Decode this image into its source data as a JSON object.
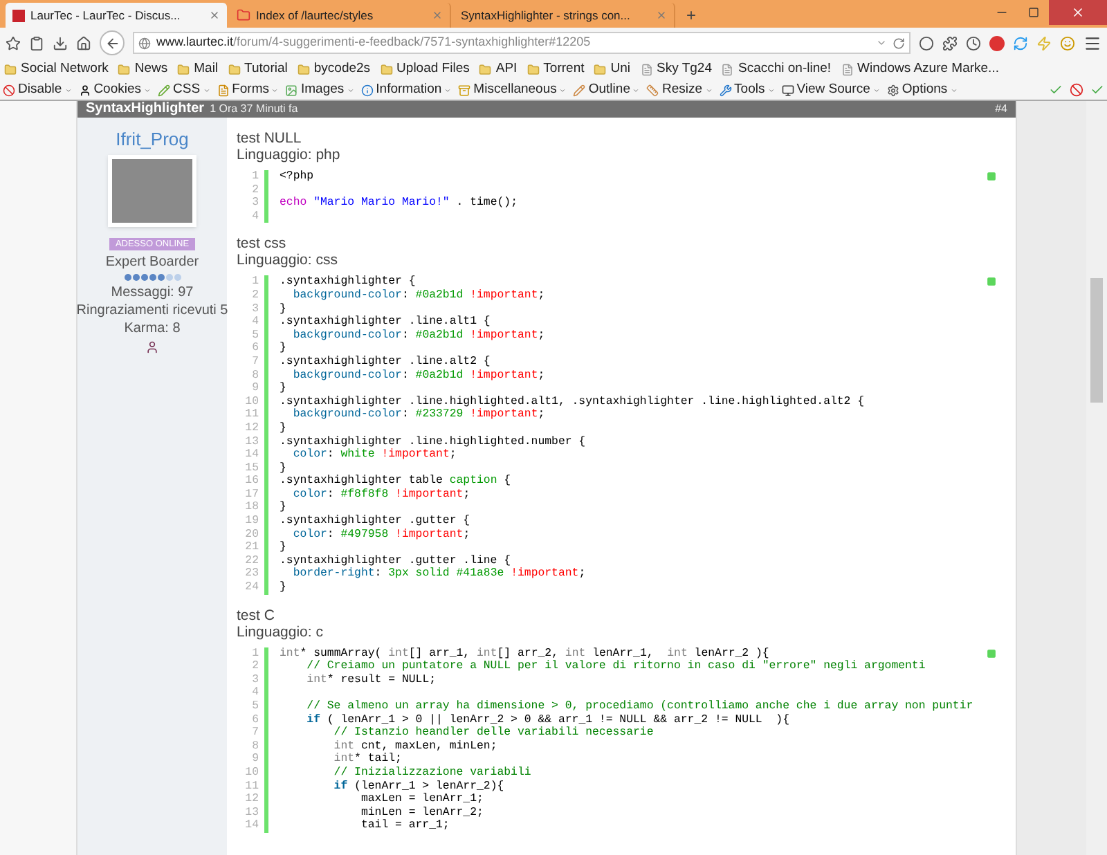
{
  "browser": {
    "tabs": [
      {
        "title": "LaurTec - LaurTec - Discus...",
        "selected": true
      },
      {
        "title": "Index of /laurtec/styles",
        "selected": false
      },
      {
        "title": "SyntaxHighlighter - strings con...",
        "selected": false
      }
    ],
    "new_tab": "+",
    "address": {
      "domain": "www.laurtec.it",
      "path": "/forum/4-suggerimenti-e-feedback/7571-syntaxhighlighter#12205"
    },
    "bookmarks": [
      {
        "label": "Social Network",
        "kind": "folder"
      },
      {
        "label": "News",
        "kind": "folder"
      },
      {
        "label": "Mail",
        "kind": "folder"
      },
      {
        "label": "Tutorial",
        "kind": "folder"
      },
      {
        "label": "bycode2s",
        "kind": "folder"
      },
      {
        "label": "Upload Files",
        "kind": "folder"
      },
      {
        "label": "API",
        "kind": "folder"
      },
      {
        "label": "Torrent",
        "kind": "folder"
      },
      {
        "label": "Uni",
        "kind": "folder"
      },
      {
        "label": "Sky Tg24",
        "kind": "page"
      },
      {
        "label": "Scacchi on-line!",
        "kind": "page"
      },
      {
        "label": "Windows Azure Marke...",
        "kind": "page"
      }
    ],
    "dev_toolbar": [
      {
        "label": "Disable",
        "kind": "disable"
      },
      {
        "label": "Cookies",
        "kind": "cookies"
      },
      {
        "label": "CSS",
        "kind": "css"
      },
      {
        "label": "Forms",
        "kind": "forms"
      },
      {
        "label": "Images",
        "kind": "images"
      },
      {
        "label": "Information",
        "kind": "info"
      },
      {
        "label": "Miscellaneous",
        "kind": "misc"
      },
      {
        "label": "Outline",
        "kind": "outline"
      },
      {
        "label": "Resize",
        "kind": "resize"
      },
      {
        "label": "Tools",
        "kind": "tools"
      },
      {
        "label": "View Source",
        "kind": "source"
      },
      {
        "label": "Options",
        "kind": "options"
      }
    ]
  },
  "post": {
    "title": "SyntaxHighlighter",
    "time": "1 Ora 37 Minuti fa",
    "number": "#4",
    "author": {
      "name": "Ifrit_Prog",
      "status": "ADESSO ONLINE",
      "rank": "Expert Boarder",
      "stars": 5,
      "posts": "Messaggi: 97",
      "thanks": "Ringraziamenti ricevuti 5",
      "karma": "Karma: 8"
    },
    "blocks": [
      {
        "title": "test NULL",
        "language": "Linguaggio: php",
        "lines": [
          {
            "n": "1",
            "t": [
              {
                "text": "<?php",
                "kind": "plain"
              }
            ]
          },
          {
            "n": "2"
          },
          {
            "n": "3",
            "t": [
              {
                "text": "echo",
                "kind": "echo"
              },
              {
                "text": " \"Mario Mario Mario!\"",
                "kind": "string"
              },
              {
                "text": " . time();",
                "kind": "plain"
              }
            ]
          },
          {
            "n": "4"
          }
        ]
      },
      {
        "title": "test css",
        "language": "Linguaggio: css",
        "lines": [
          {
            "n": "1",
            "t": [
              {
                "text": ".syntaxhighlighter {",
                "kind": "plain"
              }
            ]
          },
          {
            "n": "2",
            "t": [
              {
                "text": "  background-color",
                "kind": "property"
              },
              {
                "text": ": ",
                "kind": "plain"
              },
              {
                "text": "#0a2b1d ",
                "kind": "value"
              },
              {
                "text": "!important",
                "kind": "important"
              },
              {
                "text": ";",
                "kind": "plain"
              }
            ]
          },
          {
            "n": "3",
            "t": [
              {
                "text": "}",
                "kind": "plain"
              }
            ]
          },
          {
            "n": "4",
            "t": [
              {
                "text": ".syntaxhighlighter .line.alt1 {",
                "kind": "plain"
              }
            ]
          },
          {
            "n": "5",
            "t": [
              {
                "text": "  background-color",
                "kind": "property"
              },
              {
                "text": ": ",
                "kind": "plain"
              },
              {
                "text": "#0a2b1d ",
                "kind": "value"
              },
              {
                "text": "!important",
                "kind": "important"
              },
              {
                "text": ";",
                "kind": "plain"
              }
            ]
          },
          {
            "n": "6",
            "t": [
              {
                "text": "}",
                "kind": "plain"
              }
            ]
          },
          {
            "n": "7",
            "t": [
              {
                "text": ".syntaxhighlighter .line.alt2 {",
                "kind": "plain"
              }
            ]
          },
          {
            "n": "8",
            "t": [
              {
                "text": "  background-color",
                "kind": "property"
              },
              {
                "text": ": ",
                "kind": "plain"
              },
              {
                "text": "#0a2b1d ",
                "kind": "value"
              },
              {
                "text": "!important",
                "kind": "important"
              },
              {
                "text": ";",
                "kind": "plain"
              }
            ]
          },
          {
            "n": "9",
            "t": [
              {
                "text": "}",
                "kind": "plain"
              }
            ]
          },
          {
            "n": "10",
            "t": [
              {
                "text": ".syntaxhighlighter .line.highlighted.alt1, .syntaxhighlighter .line.highlighted.alt2 {",
                "kind": "plain"
              }
            ]
          },
          {
            "n": "11",
            "t": [
              {
                "text": "  background-color",
                "kind": "property"
              },
              {
                "text": ": ",
                "kind": "plain"
              },
              {
                "text": "#233729 ",
                "kind": "value"
              },
              {
                "text": "!important",
                "kind": "important"
              },
              {
                "text": ";",
                "kind": "plain"
              }
            ]
          },
          {
            "n": "12",
            "t": [
              {
                "text": "}",
                "kind": "plain"
              }
            ]
          },
          {
            "n": "13",
            "t": [
              {
                "text": ".syntaxhighlighter .line.highlighted.number {",
                "kind": "plain"
              }
            ]
          },
          {
            "n": "14",
            "t": [
              {
                "text": "  color",
                "kind": "property"
              },
              {
                "text": ": ",
                "kind": "plain"
              },
              {
                "text": "white ",
                "kind": "value"
              },
              {
                "text": "!important",
                "kind": "important"
              },
              {
                "text": ";",
                "kind": "plain"
              }
            ]
          },
          {
            "n": "15",
            "t": [
              {
                "text": "}",
                "kind": "plain"
              }
            ]
          },
          {
            "n": "16",
            "t": [
              {
                "text": ".syntaxhighlighter table ",
                "kind": "plain"
              },
              {
                "text": "caption",
                "kind": "value"
              },
              {
                "text": " {",
                "kind": "plain"
              }
            ]
          },
          {
            "n": "17",
            "t": [
              {
                "text": "  color",
                "kind": "property"
              },
              {
                "text": ": ",
                "kind": "plain"
              },
              {
                "text": "#f8f8f8 ",
                "kind": "value"
              },
              {
                "text": "!important",
                "kind": "important"
              },
              {
                "text": ";",
                "kind": "plain"
              }
            ]
          },
          {
            "n": "18",
            "t": [
              {
                "text": "}",
                "kind": "plain"
              }
            ]
          },
          {
            "n": "19",
            "t": [
              {
                "text": ".syntaxhighlighter .gutter {",
                "kind": "plain"
              }
            ]
          },
          {
            "n": "20",
            "t": [
              {
                "text": "  color",
                "kind": "property"
              },
              {
                "text": ": ",
                "kind": "plain"
              },
              {
                "text": "#497958 ",
                "kind": "value"
              },
              {
                "text": "!important",
                "kind": "important"
              },
              {
                "text": ";",
                "kind": "plain"
              }
            ]
          },
          {
            "n": "21",
            "t": [
              {
                "text": "}",
                "kind": "plain"
              }
            ]
          },
          {
            "n": "22",
            "t": [
              {
                "text": ".syntaxhighlighter .gutter .line {",
                "kind": "plain"
              }
            ]
          },
          {
            "n": "23",
            "t": [
              {
                "text": "  border-right",
                "kind": "property"
              },
              {
                "text": ": ",
                "kind": "plain"
              },
              {
                "text": "3px solid #41a83e ",
                "kind": "value"
              },
              {
                "text": "!important",
                "kind": "important"
              },
              {
                "text": ";",
                "kind": "plain"
              }
            ]
          },
          {
            "n": "24",
            "t": [
              {
                "text": "}",
                "kind": "plain"
              }
            ]
          }
        ]
      },
      {
        "title": "test C",
        "language": "Linguaggio: c",
        "lines": [
          {
            "n": "1",
            "t": [
              {
                "text": "int",
                "kind": "type"
              },
              {
                "text": "* summArray( ",
                "kind": "plain"
              },
              {
                "text": "int",
                "kind": "type"
              },
              {
                "text": "[] arr_1, ",
                "kind": "plain"
              },
              {
                "text": "int",
                "kind": "type"
              },
              {
                "text": "[] arr_2, ",
                "kind": "plain"
              },
              {
                "text": "int",
                "kind": "type"
              },
              {
                "text": " lenArr_1,  ",
                "kind": "plain"
              },
              {
                "text": "int",
                "kind": "type"
              },
              {
                "text": " lenArr_2 ){",
                "kind": "plain"
              }
            ]
          },
          {
            "n": "2",
            "t": [
              {
                "text": "    // Creiamo un puntatore a NULL per il valore di ritorno in caso di \"errore\" negli argomenti",
                "kind": "comment"
              }
            ]
          },
          {
            "n": "3",
            "t": [
              {
                "text": "    int",
                "kind": "type"
              },
              {
                "text": "* result = NULL;",
                "kind": "plain"
              }
            ]
          },
          {
            "n": "4"
          },
          {
            "n": "5",
            "t": [
              {
                "text": "    // Se almeno un array ha dimensione > 0, procediamo (controlliamo anche che i due array non puntir",
                "kind": "comment"
              }
            ]
          },
          {
            "n": "6",
            "t": [
              {
                "text": "    if",
                "kind": "keyword"
              },
              {
                "text": " ( lenArr_1 > 0 || lenArr_2 > 0 && arr_1 != NULL && arr_2 != NULL  ){",
                "kind": "plain"
              }
            ]
          },
          {
            "n": "7",
            "t": [
              {
                "text": "        // Istanzio heandler delle variabili necessarie",
                "kind": "comment"
              }
            ]
          },
          {
            "n": "8",
            "t": [
              {
                "text": "        int",
                "kind": "type"
              },
              {
                "text": " cnt, maxLen, minLen;",
                "kind": "plain"
              }
            ]
          },
          {
            "n": "9",
            "t": [
              {
                "text": "        int",
                "kind": "type"
              },
              {
                "text": "* tail;",
                "kind": "plain"
              }
            ]
          },
          {
            "n": "10",
            "t": [
              {
                "text": "        // Inizializzazione variabili",
                "kind": "comment"
              }
            ]
          },
          {
            "n": "11",
            "t": [
              {
                "text": "        if",
                "kind": "keyword"
              },
              {
                "text": " (lenArr_1 > lenArr_2){",
                "kind": "plain"
              }
            ]
          },
          {
            "n": "12",
            "t": [
              {
                "text": "            maxLen = lenArr_1;",
                "kind": "plain"
              }
            ]
          },
          {
            "n": "13",
            "t": [
              {
                "text": "            minLen = lenArr_2;",
                "kind": "plain"
              }
            ]
          },
          {
            "n": "14",
            "t": [
              {
                "text": "            tail = arr_1;",
                "kind": "plain"
              }
            ]
          }
        ]
      }
    ]
  }
}
